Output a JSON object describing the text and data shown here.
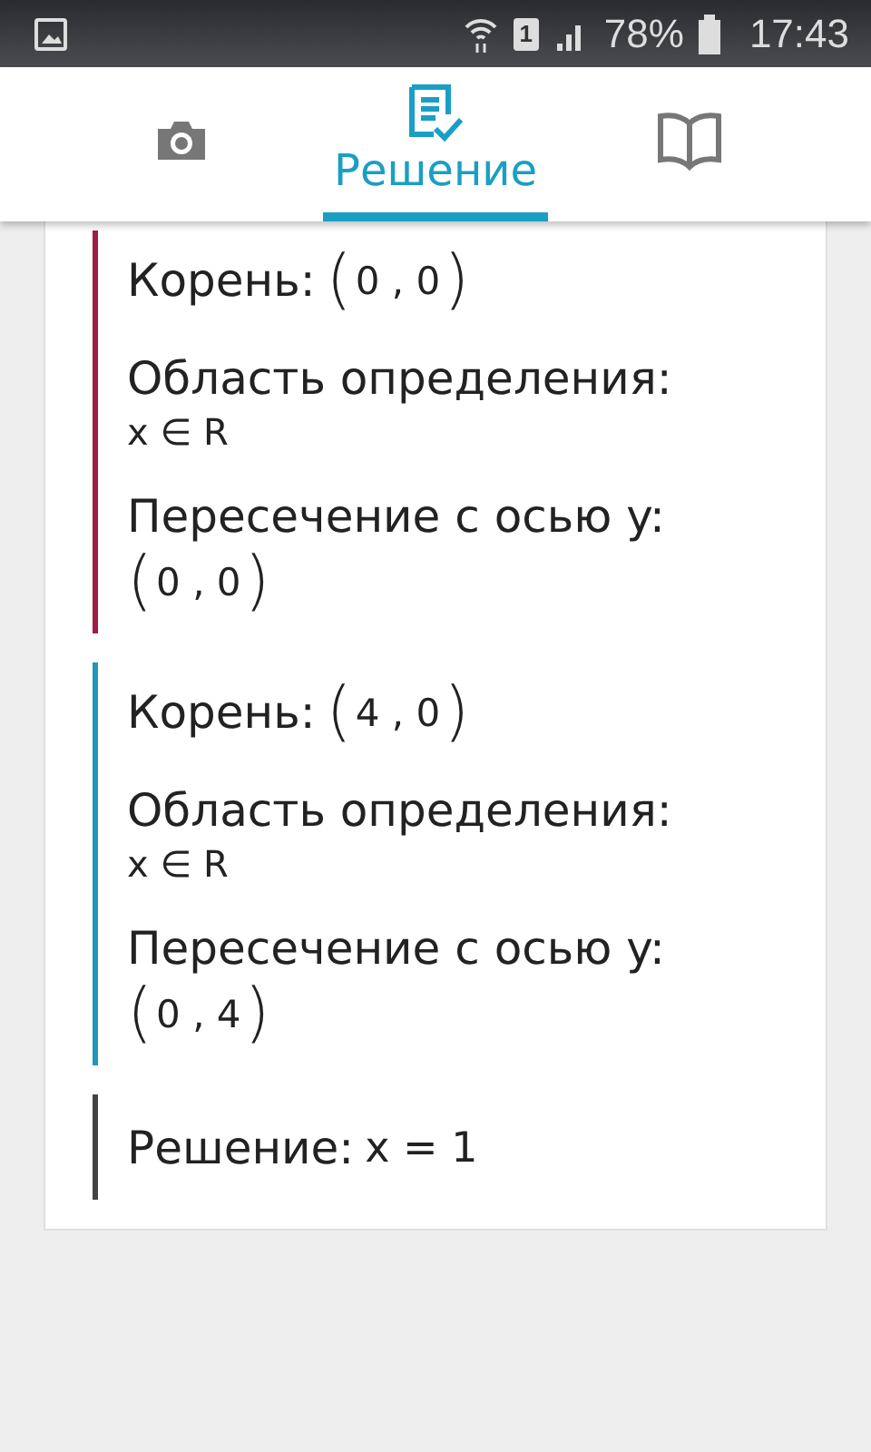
{
  "status_bar": {
    "sim": "1",
    "battery_text": "78%",
    "time": "17:43"
  },
  "tabs": [
    {
      "kind": "camera",
      "selected": false
    },
    {
      "kind": "solution",
      "label": "Решение",
      "selected": true
    },
    {
      "kind": "book",
      "selected": false
    }
  ],
  "sections": [
    {
      "color": "#9e1e44",
      "rows": [
        {
          "kind": "inline",
          "label": "Корень:",
          "value": {
            "kind": "point",
            "open": "(",
            "coords": "0 , 0",
            "close": ")"
          }
        },
        {
          "kind": "block",
          "label": "Область определения:",
          "value": {
            "kind": "text",
            "text": "x ∈ R"
          }
        },
        {
          "kind": "block",
          "label": "Пересечение с осью y:",
          "value": {
            "kind": "point",
            "open": "(",
            "coords": "0 , 0",
            "close": ")"
          }
        }
      ]
    },
    {
      "color": "#2196b8",
      "rows": [
        {
          "kind": "inline",
          "label": "Корень:",
          "value": {
            "kind": "point",
            "open": "(",
            "coords": "4 , 0",
            "close": ")"
          }
        },
        {
          "kind": "block",
          "label": "Область определения:",
          "value": {
            "kind": "text",
            "text": "x ∈ R"
          }
        },
        {
          "kind": "block",
          "label": "Пересечение с осью y:",
          "value": {
            "kind": "point",
            "open": "(",
            "coords": "0 , 4",
            "close": ")"
          }
        }
      ]
    },
    {
      "color": "#444444",
      "rows": [
        {
          "kind": "inline",
          "label": "Решение:",
          "value": {
            "kind": "text",
            "text": "x = 1"
          }
        }
      ]
    }
  ]
}
